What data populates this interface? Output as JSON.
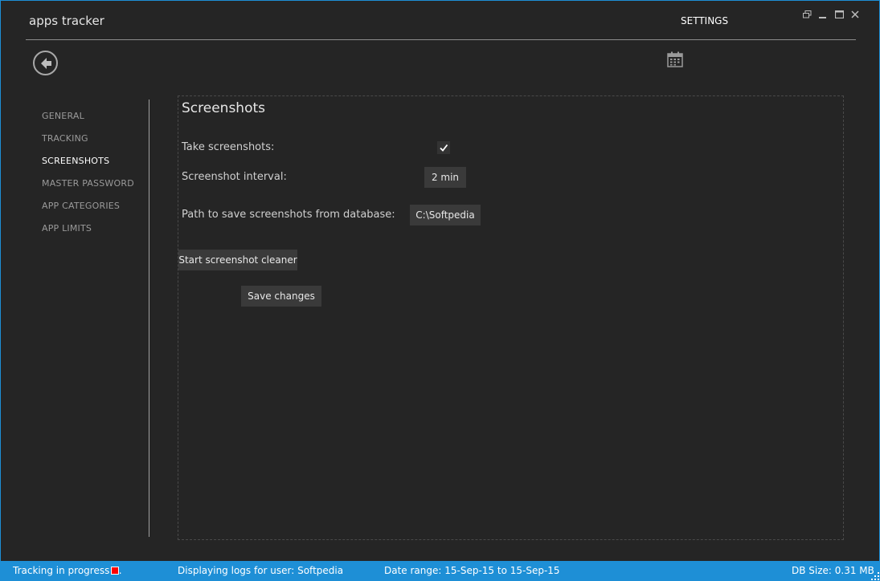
{
  "window": {
    "app_title": "apps tracker",
    "section_title": "SETTINGS",
    "controls": {
      "restore": "restore-icon",
      "minimize": "minimize-icon",
      "maximize": "maximize-icon",
      "close": "close-icon"
    }
  },
  "toolbar": {
    "back_icon": "back-arrow-icon",
    "calendar_icon": "calendar-icon"
  },
  "sidebar": {
    "items": [
      {
        "label": "GENERAL",
        "active": false
      },
      {
        "label": "TRACKING",
        "active": false
      },
      {
        "label": "SCREENSHOTS",
        "active": true
      },
      {
        "label": "MASTER PASSWORD",
        "active": false
      },
      {
        "label": "APP CATEGORIES",
        "active": false
      },
      {
        "label": "APP LIMITS",
        "active": false
      }
    ]
  },
  "panel": {
    "title": "Screenshots",
    "take_screenshots_label": "Take screenshots:",
    "take_screenshots_checked": true,
    "interval_label": "Screenshot interval:",
    "interval_value": "2 min",
    "path_label": "Path to save screenshots from database:",
    "path_value": "C:\\Softpedia",
    "cleaner_button": "Start screenshot cleaner",
    "save_button": "Save changes"
  },
  "statusbar": {
    "tracking": "Tracking in progress ...",
    "user": "Displaying logs for user: Softpedia",
    "date_range": "Date range: 15-Sep-15 to 15-Sep-15",
    "db_size": "DB Size: 0.31 MB"
  },
  "colors": {
    "accent": "#1e8fd6",
    "background": "#252525",
    "recording": "#ff0000"
  }
}
